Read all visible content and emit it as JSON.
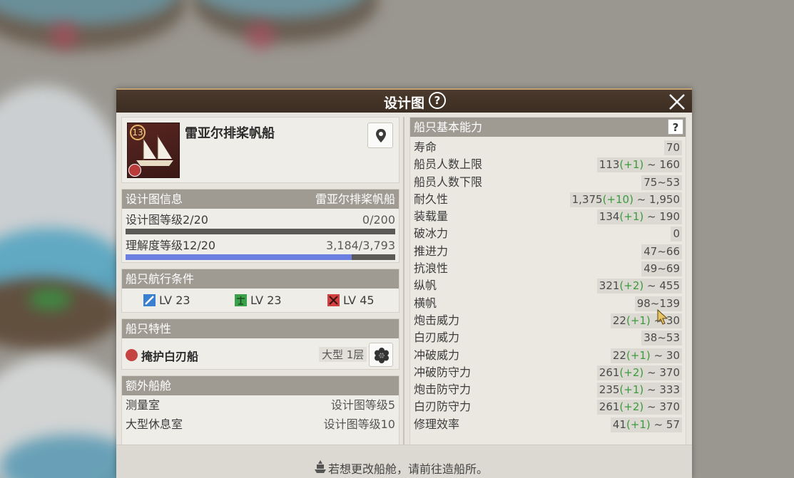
{
  "dialog": {
    "title": "设计图",
    "help": "?",
    "footer_text": "若想更改船舱，请前往造船所。"
  },
  "ship": {
    "name": "雷亚尔排桨帆船",
    "grade": "13"
  },
  "blueprint_info": {
    "header": "设计图信息",
    "header_right": "雷亚尔排桨帆船",
    "blueprint_level_label": "设计图等级2/20",
    "blueprint_level_value": "0/200",
    "blueprint_progress": 0,
    "understanding_label": "理解度等级12/20",
    "understanding_value": "3,184/3,793",
    "understanding_progress": 0.8394
  },
  "sail_conditions": {
    "header": "船只航行条件",
    "items": [
      {
        "label": "LV 23",
        "icon": "adventure-icon",
        "color": "#3a7fd0"
      },
      {
        "label": "LV 23",
        "icon": "trade-icon",
        "color": "#3aa04a"
      },
      {
        "label": "LV 45",
        "icon": "battle-icon",
        "color": "#d04040"
      }
    ]
  },
  "ship_traits": {
    "header": "船只特性",
    "name": "掩护白刃船",
    "size": "大型 1层"
  },
  "extra_cabins": {
    "header": "额外船舱",
    "rows": [
      {
        "name": "测量室",
        "req": "设计图等级5"
      },
      {
        "name": "大型休息室",
        "req": "设计图等级10"
      }
    ]
  },
  "basic_stats": {
    "header": "船只基本能力",
    "help": "?",
    "rows": [
      {
        "name": "寿命",
        "base": "70",
        "bonus": "",
        "max": ""
      },
      {
        "name": "船员人数上限",
        "base": "113",
        "bonus": "(+1)",
        "max": " ~ 160"
      },
      {
        "name": "船员人数下限",
        "base": "75~53",
        "bonus": "",
        "max": ""
      },
      {
        "name": "耐久性",
        "base": "1,375",
        "bonus": "(+10)",
        "max": " ~ 1,950"
      },
      {
        "name": "装载量",
        "base": "134",
        "bonus": "(+1)",
        "max": " ~ 190"
      },
      {
        "name": "破冰力",
        "base": "0",
        "bonus": "",
        "max": ""
      },
      {
        "name": "推进力",
        "base": "47~66",
        "bonus": "",
        "max": ""
      },
      {
        "name": "抗浪性",
        "base": "49~69",
        "bonus": "",
        "max": ""
      },
      {
        "name": "纵帆",
        "base": "321",
        "bonus": "(+2)",
        "max": " ~ 455"
      },
      {
        "name": "横帆",
        "base": "98~139",
        "bonus": "",
        "max": ""
      },
      {
        "name": "炮击威力",
        "base": "22",
        "bonus": "(+1)",
        "max": " ~ 30"
      },
      {
        "name": "白刃威力",
        "base": "38~53",
        "bonus": "",
        "max": ""
      },
      {
        "name": "冲破威力",
        "base": "22",
        "bonus": "(+1)",
        "max": " ~ 30"
      },
      {
        "name": "冲破防守力",
        "base": "261",
        "bonus": "(+2)",
        "max": " ~ 370"
      },
      {
        "name": "炮击防守力",
        "base": "235",
        "bonus": "(+1)",
        "max": " ~ 333"
      },
      {
        "name": "白刃防守力",
        "base": "261",
        "bonus": "(+2)",
        "max": " ~ 370"
      },
      {
        "name": "修理效率",
        "base": "41",
        "bonus": "(+1)",
        "max": " ~ 57"
      }
    ]
  }
}
